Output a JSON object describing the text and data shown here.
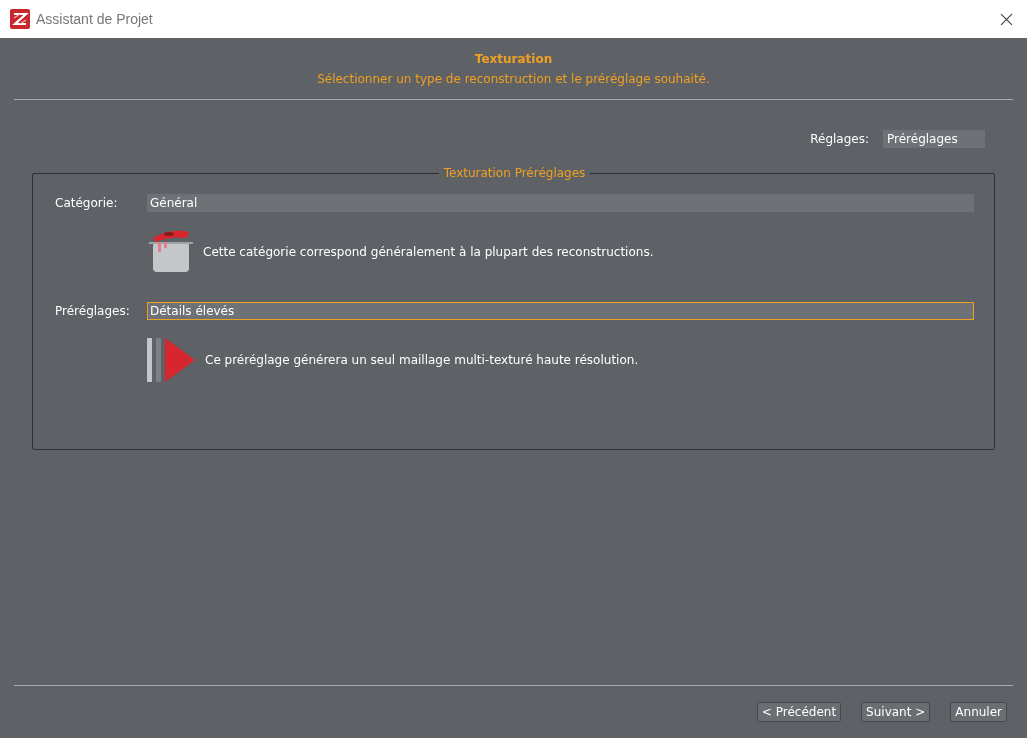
{
  "window": {
    "title": "Assistant de Projet"
  },
  "header": {
    "title": "Texturation",
    "subtitle": "Sélectionner un type de reconstruction et le préréglage souhaité."
  },
  "settings": {
    "label": "Réglages:",
    "value": "Préréglages"
  },
  "group": {
    "title": "Texturation Préréglages",
    "fields": [
      {
        "kind": "category",
        "label": "Catégorie:",
        "value": "Général",
        "focused": false,
        "description": "Cette catégorie correspond généralement à la plupart des reconstructions."
      },
      {
        "kind": "preset",
        "label": "Préréglages:",
        "value": "Détails élevés",
        "focused": true,
        "description": "Ce préréglage générera un seul maillage multi-texturé haute résolution."
      }
    ]
  },
  "buttons": [
    {
      "label": "< Précédent"
    },
    {
      "label": "Suivant >"
    },
    {
      "label": "Annuler"
    }
  ]
}
